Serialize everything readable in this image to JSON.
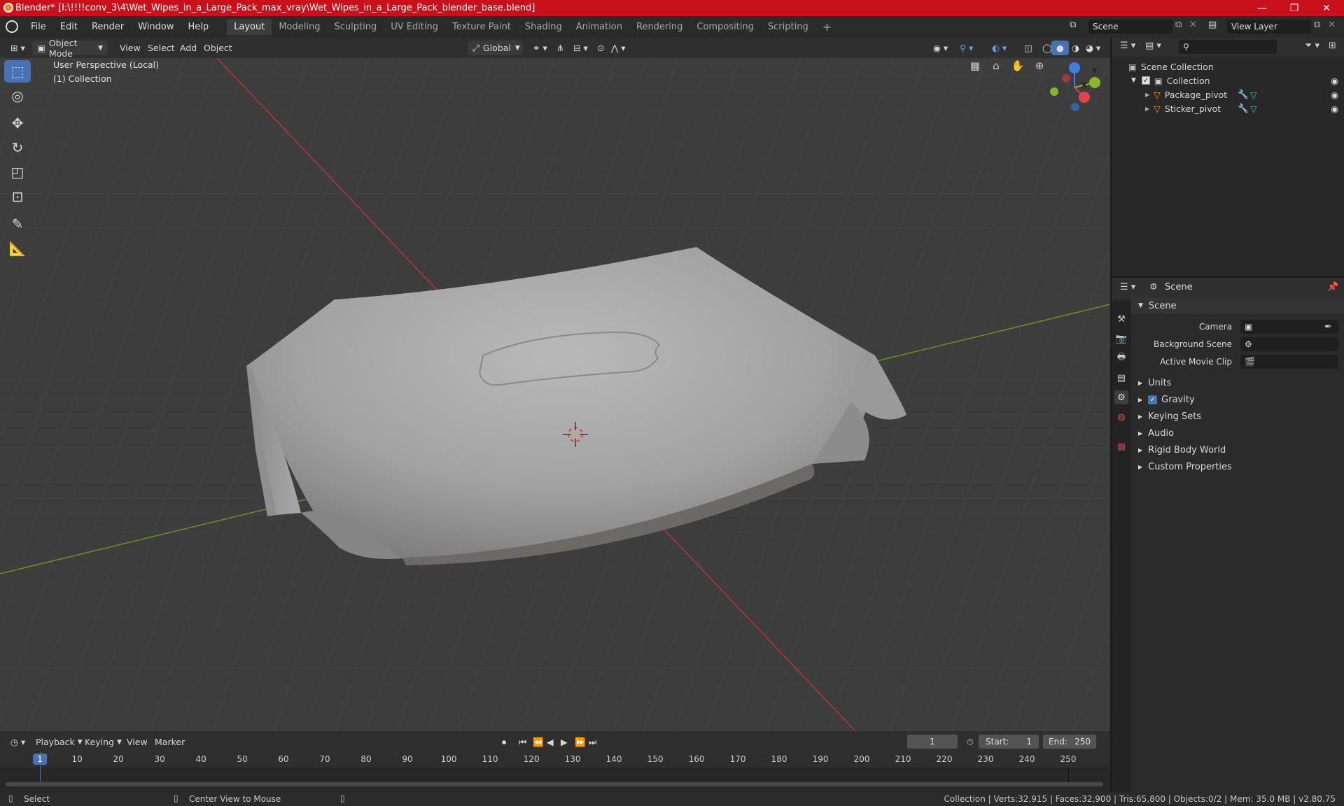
{
  "window": {
    "title": "Blender* [I:\\!!!!conv_3\\4\\Wet_Wipes_in_a_Large_Pack_max_vray\\Wet_Wipes_in_a_Large_Pack_blender_base.blend]",
    "minimize": "—",
    "maximize": "❐",
    "close": "✕"
  },
  "menubar": {
    "items": [
      "File",
      "Edit",
      "Render",
      "Window",
      "Help"
    ],
    "workspaces": [
      "Layout",
      "Modeling",
      "Sculpting",
      "UV Editing",
      "Texture Paint",
      "Shading",
      "Animation",
      "Rendering",
      "Compositing",
      "Scripting"
    ],
    "active_workspace": "Layout",
    "add_workspace": "+",
    "scene": "Scene",
    "view_layer": "View Layer"
  },
  "viewport_header": {
    "mode": "Object Mode",
    "menus": [
      "View",
      "Select",
      "Add",
      "Object"
    ],
    "orientation": "Global"
  },
  "viewport": {
    "perspective": "User Perspective (Local)",
    "collection": "(1) Collection",
    "gizmo": {
      "z": "Z",
      "y": "Y",
      "x": "X"
    }
  },
  "outliner": {
    "root": "Scene Collection",
    "collection": "Collection",
    "objects": [
      "Package_pivot",
      "Sticker_pivot"
    ]
  },
  "properties": {
    "context": "Scene",
    "panel_title": "Scene",
    "fields": [
      {
        "label": "Camera",
        "value": ""
      },
      {
        "label": "Background Scene",
        "value": ""
      },
      {
        "label": "Active Movie Clip",
        "value": ""
      }
    ],
    "sections": [
      "Units",
      "Gravity",
      "Keying Sets",
      "Audio",
      "Rigid Body World",
      "Custom Properties"
    ],
    "gravity_checked": true
  },
  "timeline": {
    "menus": [
      "Playback",
      "Keying",
      "View",
      "Marker"
    ],
    "current_frame": "1",
    "start_label": "Start:",
    "start": "1",
    "end_label": "End:",
    "end": "250",
    "ticks": [
      "1",
      "10",
      "20",
      "30",
      "40",
      "50",
      "60",
      "70",
      "80",
      "90",
      "100",
      "110",
      "120",
      "130",
      "140",
      "150",
      "160",
      "170",
      "180",
      "190",
      "200",
      "210",
      "220",
      "230",
      "240",
      "250"
    ]
  },
  "statusbar": {
    "select": "Select",
    "center_view": "Center View to Mouse",
    "stats": "Collection | Verts:32,915 | Faces:32,900 | Tris:65,800 | Objects:0/2 | Mem: 35.0 MB | v2.80.75"
  },
  "colors": {
    "title_red": "#c8111b",
    "accent_blue": "#4772b3",
    "x_axis": "#e2424f",
    "y_axis": "#8bb52d",
    "z_axis": "#3f7ee0"
  }
}
